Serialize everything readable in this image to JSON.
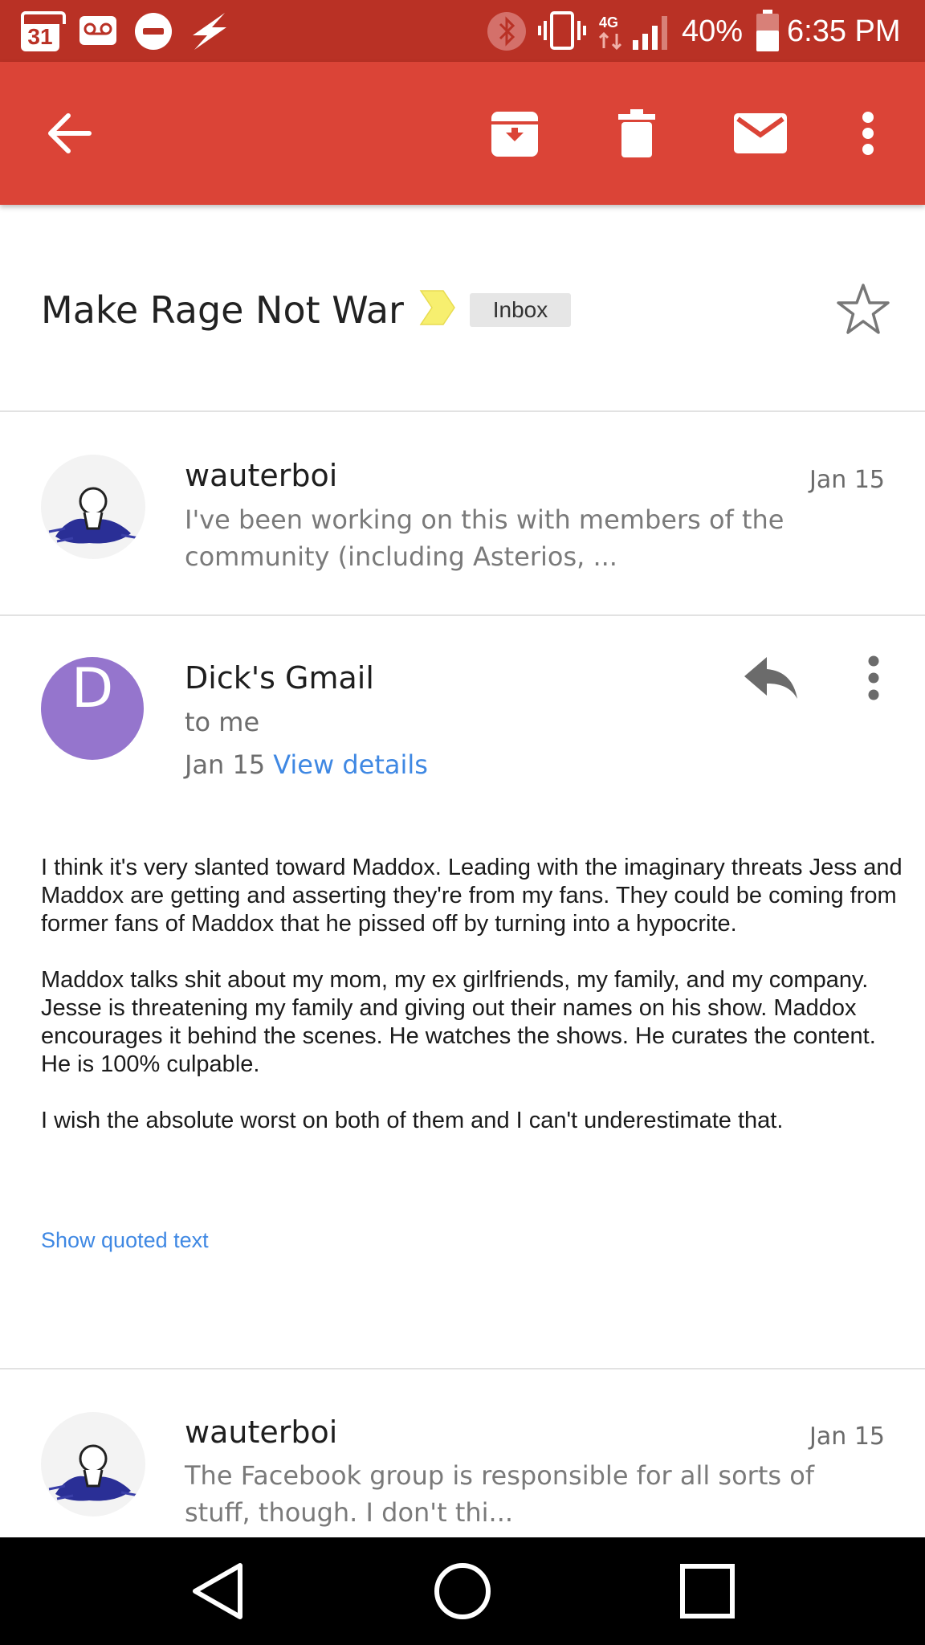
{
  "status_bar": {
    "calendar_day": "31",
    "network": "4G",
    "battery": "40%",
    "time": "6:35 PM",
    "icons": [
      "calendar-icon",
      "voicemail-icon",
      "do-not-disturb-icon",
      "flash-icon",
      "bluetooth-icon",
      "vibrate-icon",
      "signal-icon",
      "battery-icon"
    ]
  },
  "toolbar": {
    "icons": [
      "back-arrow-icon",
      "archive-icon",
      "delete-icon",
      "mark-unread-icon",
      "overflow-menu-icon"
    ]
  },
  "thread": {
    "subject": "Make Rage Not War",
    "label": "Inbox",
    "important_color": "#f7ef6f"
  },
  "messages": [
    {
      "sender": "wauterboi",
      "date": "Jan 15",
      "snippet": "I've been working on this with members of the community (including Asterios, ..."
    },
    {
      "sender": "Dick's Gmail",
      "avatar_letter": "D",
      "avatar_color": "#9575cd",
      "recipient": "to me",
      "date": "Jan 15",
      "details_link": "View details",
      "body": [
        "I think it's very slanted toward Maddox. Leading with the imaginary threats Jess and Maddox are getting and asserting they're from my fans. They could be coming from former fans of Maddox that he pissed off by turning into a hypocrite.",
        "Maddox talks shit about my mom, my ex girlfriends, my family, and my company. Jesse is threatening my family and giving out their names on his show. Maddox encourages it behind the scenes. He watches the shows. He curates the content. He is 100% culpable.",
        "I wish the absolute worst on both of them and I can't underestimate that."
      ],
      "quoted_link": "Show quoted text"
    },
    {
      "sender": "wauterboi",
      "date": "Jan 15",
      "snippet": "The Facebook group is responsible for all sorts of stuff, though. I don't thi..."
    }
  ],
  "colors": {
    "status_bar": "#b93125",
    "app_bar": "#db4437",
    "link": "#3f88e3"
  }
}
